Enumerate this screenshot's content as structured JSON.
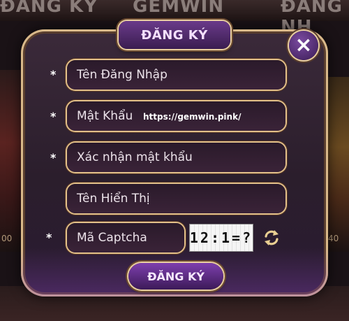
{
  "background": {
    "top_left_word": "ĐĂNG KÝ",
    "top_center_word": "GEMWIN",
    "top_right_word": "ĐĂNG NH",
    "left_number": "00",
    "right_number": "40"
  },
  "dialog": {
    "title": "ĐĂNG KÝ",
    "close_label": "×",
    "fields": {
      "username": {
        "required": "*",
        "placeholder": "Tên Đăng Nhập"
      },
      "password": {
        "required": "*",
        "placeholder": "Mật Khẩu"
      },
      "confirm_password": {
        "required": "*",
        "placeholder": "Xác nhận mật khẩu"
      },
      "display_name": {
        "required": "",
        "placeholder": "Tên Hiển Thị"
      },
      "captcha": {
        "required": "*",
        "placeholder": "Mã Captcha"
      }
    },
    "captcha_text": "12:1=?",
    "watermark_url": "https://gemwin.pink/",
    "submit_label": "ĐĂNG KÝ"
  },
  "colors": {
    "gold_border": "#e2c08a",
    "panel": "#2b1e2c",
    "button_purple": "#7e3fae"
  },
  "icons": {
    "close": "close-icon",
    "refresh": "refresh-icon"
  }
}
